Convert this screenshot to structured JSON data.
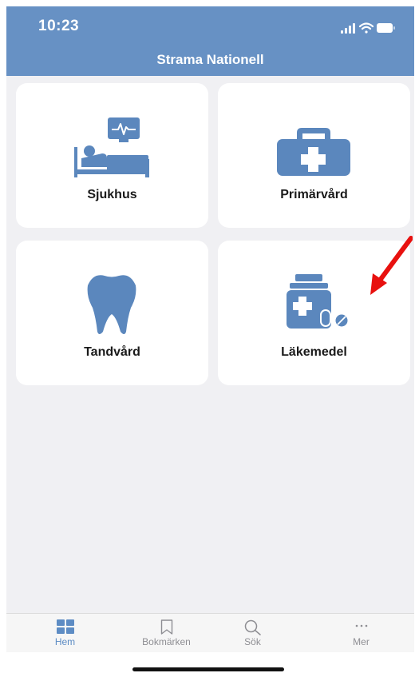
{
  "status_bar": {
    "time": "10:23"
  },
  "header": {
    "title": "Strama Nationell"
  },
  "cards": [
    {
      "label": "Sjukhus",
      "icon": "hospital-bed-monitor-icon"
    },
    {
      "label": "Primärvård",
      "icon": "medical-bag-icon"
    },
    {
      "label": "Tandvård",
      "icon": "tooth-icon"
    },
    {
      "label": "Läkemedel",
      "icon": "medicine-bottle-pills-icon"
    }
  ],
  "tab_bar": {
    "items": [
      {
        "label": "Hem",
        "icon": "grid-icon",
        "active": true
      },
      {
        "label": "Bokmärken",
        "icon": "bookmark-icon",
        "active": false
      },
      {
        "label": "Sök",
        "icon": "search-icon",
        "active": false
      },
      {
        "label": "Mer",
        "icon": "more-dots-icon",
        "active": false
      }
    ]
  },
  "colors": {
    "header_bg": "#6791c4",
    "icon_blue": "#5b87bd",
    "content_bg": "#f0f0f3",
    "annotation_arrow": "#e8110f"
  }
}
